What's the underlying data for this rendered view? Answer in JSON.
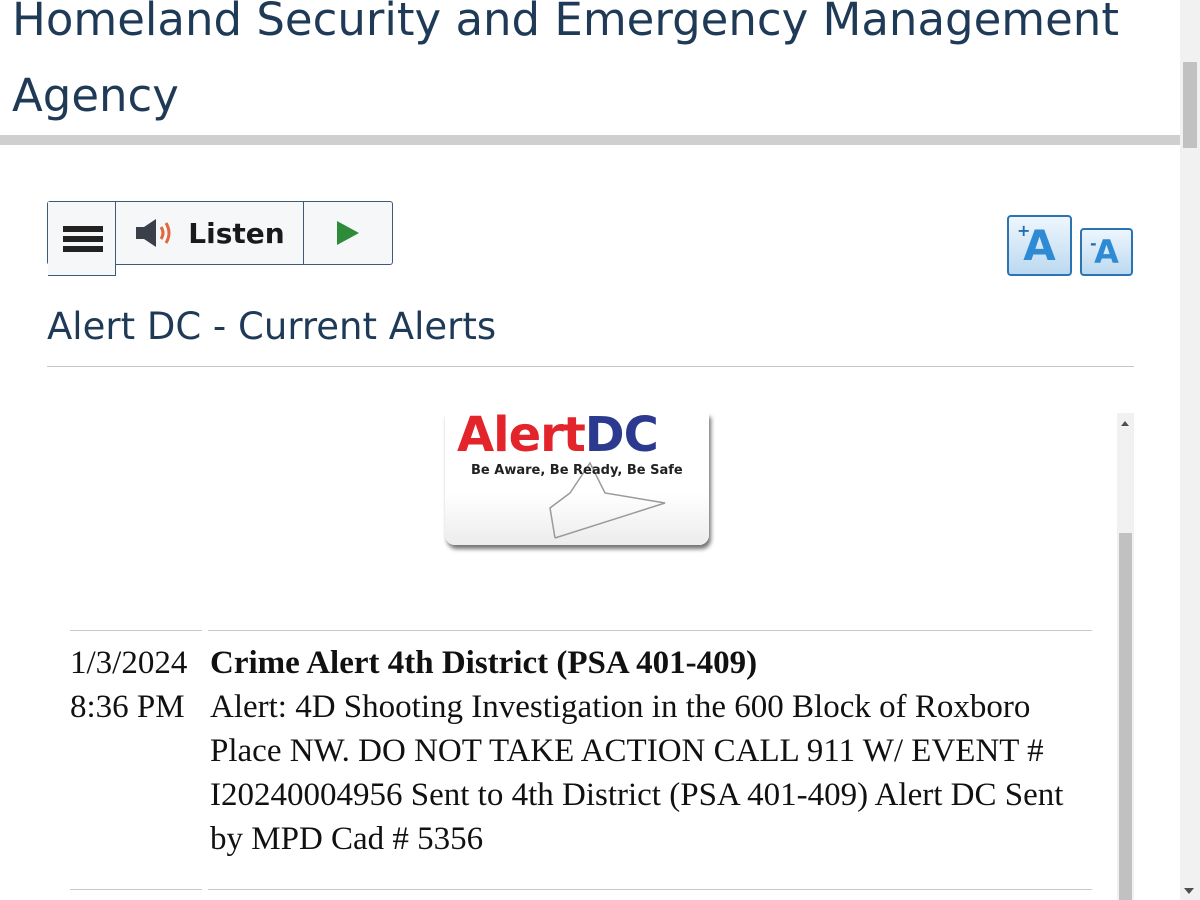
{
  "header": {
    "agency_title": "Homeland Security and Emergency Management Agency"
  },
  "toolbar": {
    "menu_icon": "hamburger-menu-icon",
    "speaker_icon": "speaker-icon",
    "listen_label": "Listen",
    "play_icon": "play-icon",
    "font_increase_label": "A",
    "font_increase_sign": "+",
    "font_decrease_label": "A",
    "font_decrease_sign": "-"
  },
  "section": {
    "title": "Alert DC - Current Alerts"
  },
  "logo": {
    "word_red": "Alert",
    "word_blue": "DC",
    "tagline": "Be Aware, Be Ready, Be Safe"
  },
  "alerts": [
    {
      "date": "1/3/2024",
      "time": "8:36 PM",
      "title": "Crime Alert 4th District (PSA 401-409)",
      "text": "Alert: 4D Shooting Investigation in the 600 Block of Roxboro Place NW. DO NOT TAKE ACTION CALL 911 W/ EVENT # I20240004956 Sent to 4th District (PSA 401-409) Alert DC Sent by MPD Cad # 5356"
    }
  ],
  "colors": {
    "title_navy": "#1f3a57",
    "logo_red": "#e3242b",
    "logo_blue": "#2b3a8e",
    "play_green": "#2e8b3a",
    "speaker_orange": "#e2673a",
    "font_button_blue": "#2d8ad3"
  }
}
